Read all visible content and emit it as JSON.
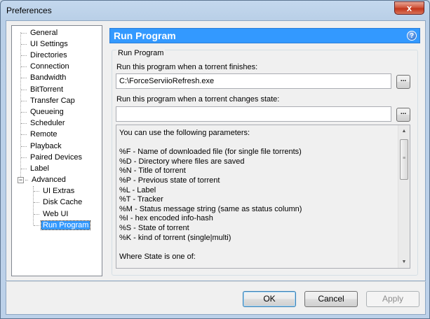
{
  "window": {
    "title": "Preferences",
    "close_label": "x"
  },
  "tree": {
    "items": [
      {
        "label": "General"
      },
      {
        "label": "UI Settings"
      },
      {
        "label": "Directories"
      },
      {
        "label": "Connection"
      },
      {
        "label": "Bandwidth"
      },
      {
        "label": "BitTorrent"
      },
      {
        "label": "Transfer Cap"
      },
      {
        "label": "Queueing"
      },
      {
        "label": "Scheduler"
      },
      {
        "label": "Remote"
      },
      {
        "label": "Playback"
      },
      {
        "label": "Paired Devices"
      },
      {
        "label": "Label"
      },
      {
        "label": "Advanced",
        "expanded": true,
        "expander": "−"
      },
      {
        "label": "UI Extras"
      },
      {
        "label": "Disk Cache"
      },
      {
        "label": "Web UI"
      },
      {
        "label": "Run Program",
        "selected": true
      }
    ]
  },
  "header": {
    "title": "Run Program",
    "help_label": "?"
  },
  "group": {
    "title": "Run Program",
    "finish_label": "Run this program when a torrent finishes:",
    "finish_value": "C:\\ForceServiioRefresh.exe",
    "change_label": "Run this program when a torrent changes state:",
    "change_value": "",
    "browse_label": "..."
  },
  "params": {
    "lines": [
      "You can use the following parameters:",
      "",
      "%F - Name of downloaded file (for single file torrents)",
      "%D - Directory where files are saved",
      "%N - Title of torrent",
      "%P - Previous state of torrent",
      "%L - Label",
      "%T - Tracker",
      "%M - Status message string (same as status column)",
      "%I - hex encoded info-hash",
      "%S - State of torrent",
      "%K - kind of torrent (single|multi)",
      "",
      "Where State is one of:"
    ]
  },
  "buttons": {
    "ok": "OK",
    "cancel": "Cancel",
    "apply": "Apply"
  },
  "colors": {
    "selection": "#3399ff",
    "header": "#3399ff"
  }
}
